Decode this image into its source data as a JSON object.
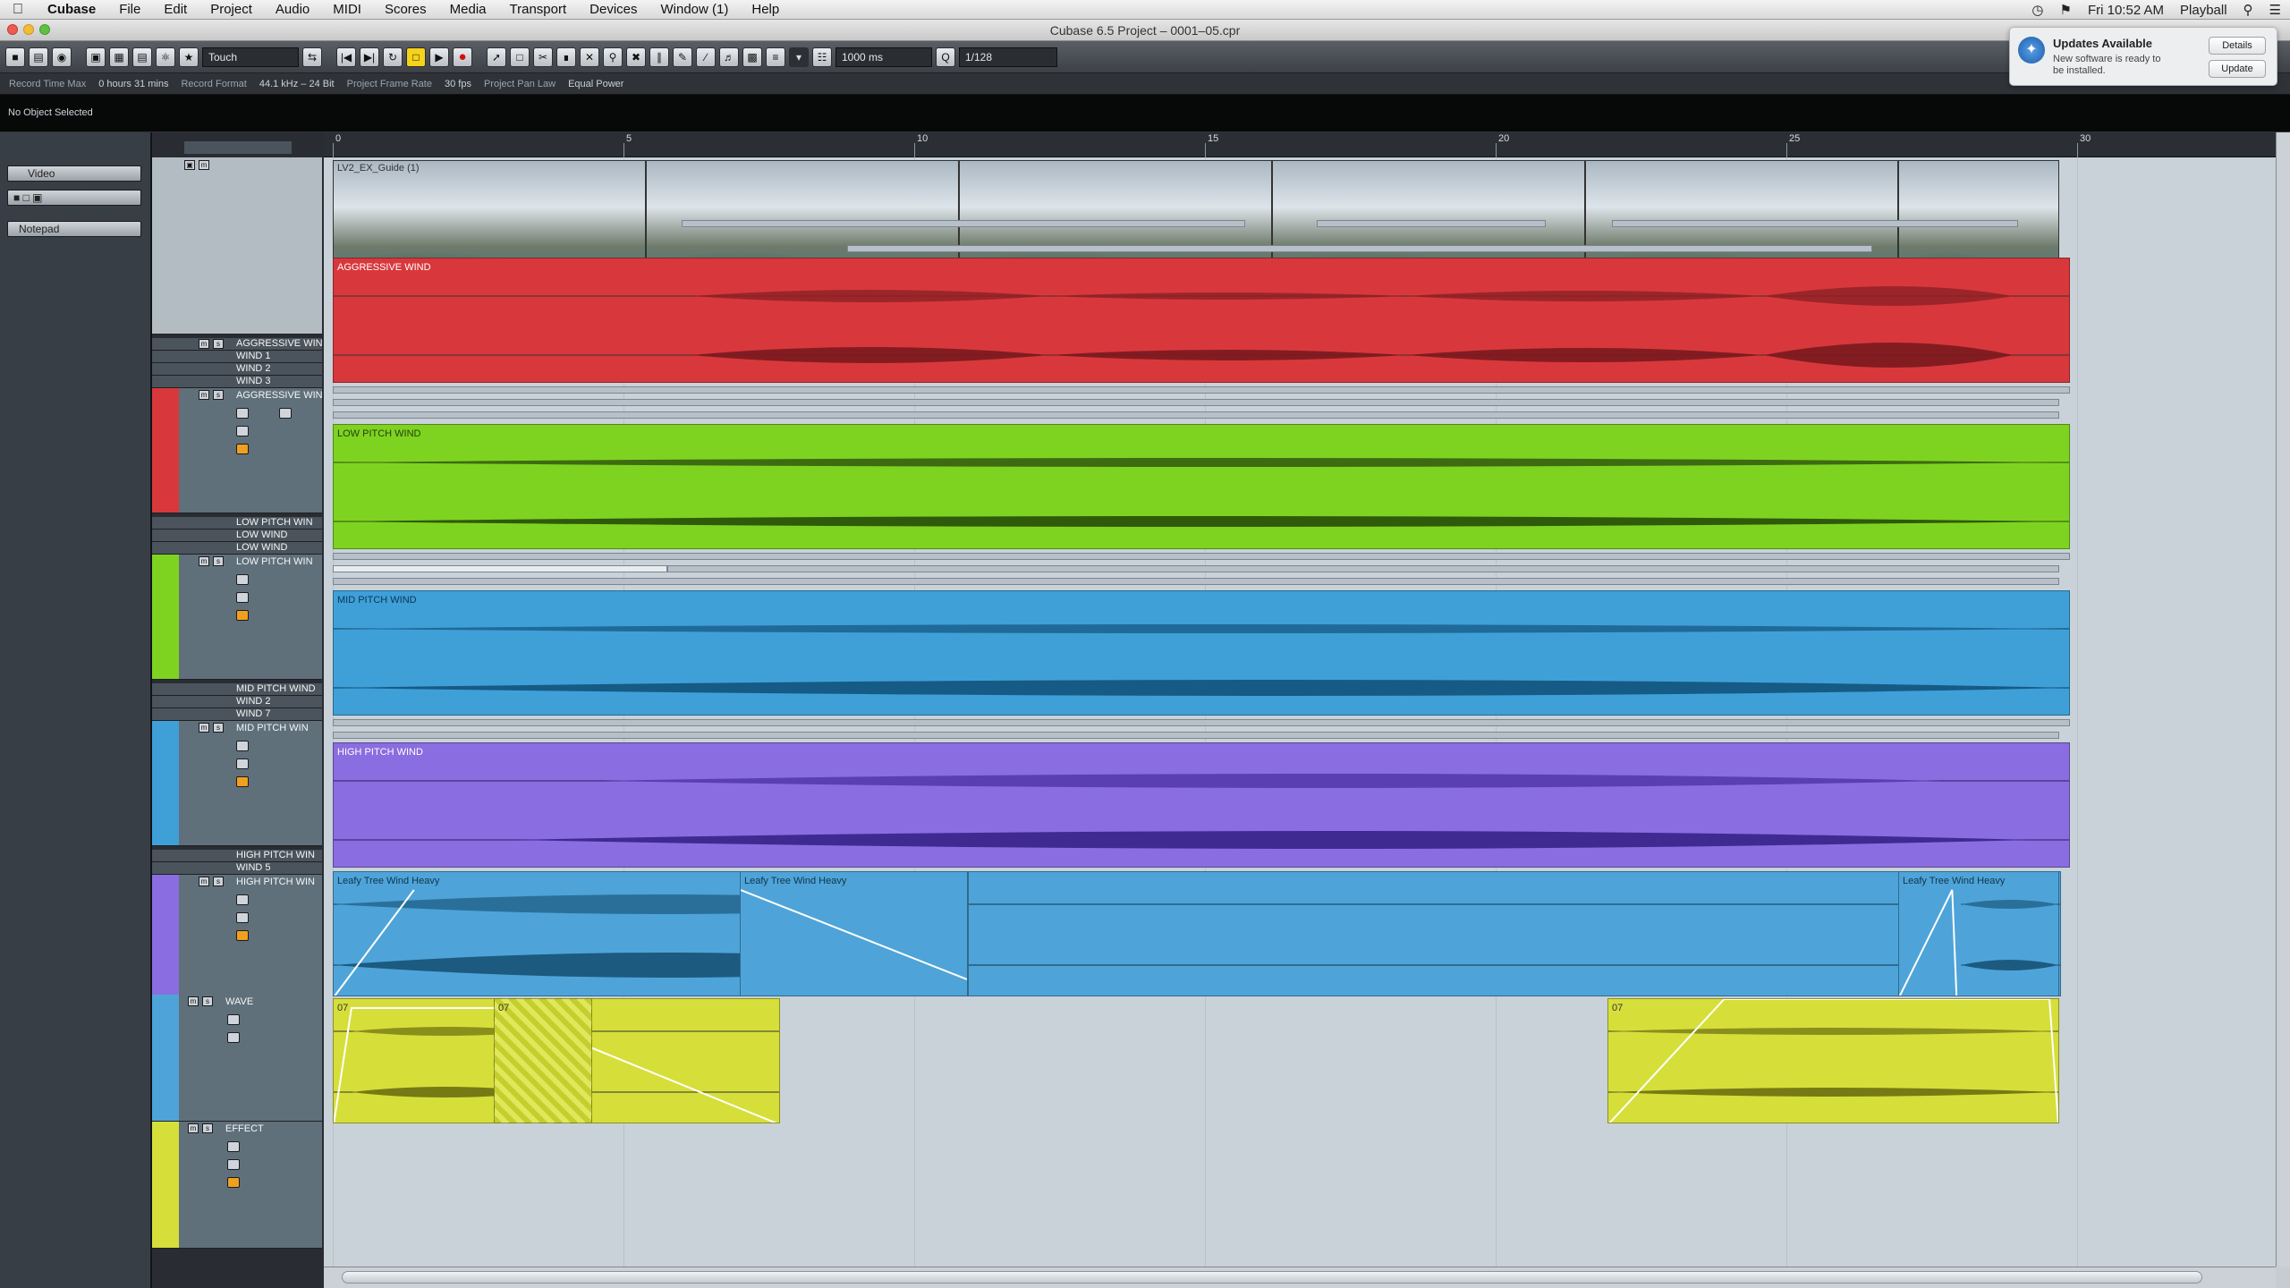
{
  "menubar": {
    "app": "Cubase",
    "items": [
      "File",
      "Edit",
      "Project",
      "Audio",
      "MIDI",
      "Scores",
      "Media",
      "Transport",
      "Devices",
      "Window (1)",
      "Help"
    ],
    "clock": "Fri 10:52 AM",
    "user": "Playball"
  },
  "window": {
    "title": "Cubase 6.5 Project – 0001–05.cpr"
  },
  "toolbar": {
    "automation_mode": "Touch",
    "nudge": "1000 ms",
    "quantize": "1/128"
  },
  "infoline": {
    "record_time_label": "Record Time Max",
    "record_time_value": "0 hours 31 mins",
    "record_format_label": "Record Format",
    "record_format_value": "44.1 kHz – 24 Bit",
    "frame_rate_label": "Project Frame Rate",
    "frame_rate_value": "30 fps",
    "pan_law_label": "Project Pan Law",
    "pan_law_value": "Equal Power"
  },
  "object_selection": "No Object Selected",
  "inspector": {
    "track_type": "Video",
    "notepad": "Notepad"
  },
  "ruler": {
    "marks": [
      "0",
      "5",
      "10",
      "15",
      "20",
      "25",
      "30"
    ]
  },
  "tracks": {
    "video_event": "LV2_EX_Guide (1)",
    "aggressive_folder": "AGGRESSIVE WIND",
    "wind1": "WIND 1",
    "wind2": "WIND 2",
    "wind3": "WIND 3",
    "aggressive_track": "AGGRESSIVE WIN",
    "aggressive_event": "AGGRESSIVE WIND",
    "low_folder": "LOW PITCH WIN",
    "low_lane_a": "LOW WIND",
    "low_lane_b": "LOW WIND",
    "low_track": "LOW PITCH WIN",
    "low_event": "LOW PITCH WIND",
    "mid_folder": "MID PITCH WIND",
    "mid_lane_a": "WIND 2",
    "mid_lane_b": "WIND 7",
    "mid_track": "MID PITCH WIN",
    "mid_event": "MID PITCH WIND",
    "high_folder": "HIGH PITCH WIN",
    "high_lane": "WIND 5",
    "high_track": "HIGH PITCH WIN",
    "high_event": "HIGH PITCH WIND",
    "wave_track": "WAVE",
    "wave_event_1": "Leafy Tree Wind Heavy",
    "wave_event_2": "Leafy Tree Wind Heavy",
    "wave_event_3": "Leafy Tree Wind Heavy",
    "effect_track": "EFFECT",
    "effect_event_1": "07",
    "effect_event_2": "07",
    "effect_event_3": "07"
  },
  "notification": {
    "title": "Updates Available",
    "body": "New software is ready to be installed.",
    "details_button": "Details",
    "update_button": "Update"
  },
  "colors": {
    "aggressive": "#d8383c",
    "low": "#7ed321",
    "mid": "#3fa0d8",
    "high": "#8a6de0",
    "wave": "#4ea4d8",
    "effect": "#d6df3a"
  }
}
